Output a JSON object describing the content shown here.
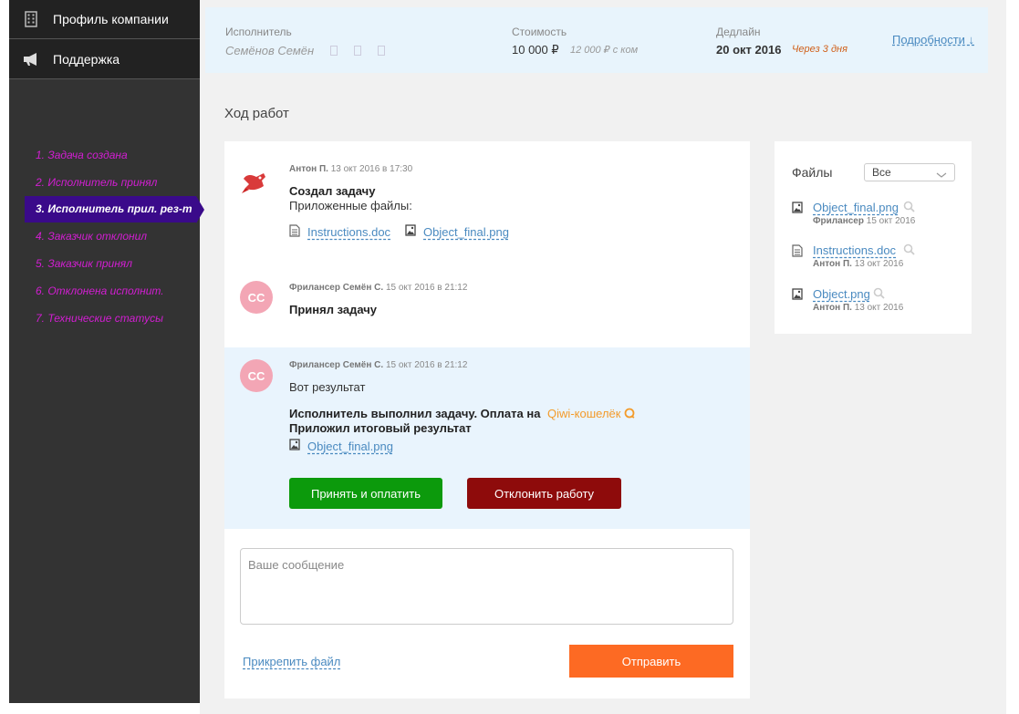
{
  "sidebar": {
    "menu": [
      {
        "label": "Профиль компании",
        "icon": "building-icon"
      },
      {
        "label": "Поддержка",
        "icon": "megaphone-icon"
      }
    ],
    "steps": [
      "1. Задача создана",
      "2. Исполнитель принял",
      "3. Исполнитель прил. рез-т",
      "4. Заказчик отклонил",
      "5. Заказчик принял",
      "6. Отклонена исполнит.",
      "7. Технические статусы"
    ],
    "active_step_index": 2
  },
  "info": {
    "executor_label": "Исполнитель",
    "executor_name": "Семёнов Семён",
    "cost_label": "Стоимость",
    "cost_value": "10 000 ₽",
    "cost_sub": "12 000 ₽ с ком",
    "deadline_label": "Дедлайн",
    "deadline_value": "20 окт 2016",
    "deadline_sub": "Через 3 дня",
    "details_link": "Подробности ↓"
  },
  "section_title": "Ход работ",
  "entries": [
    {
      "author": "Антон П.",
      "date": "13 окт 2016 в 17:30",
      "title": "Создал задачу",
      "text": "Приложенные файлы:",
      "files": [
        "Instructions.doc",
        "Object_final.png"
      ]
    },
    {
      "avatar": "СС",
      "author": "Фрилансер Семён С.",
      "date": "15 окт 2016 в 21:12",
      "title": "Принял задачу"
    },
    {
      "avatar": "СС",
      "author": "Фрилансер Семён С.",
      "date": "15 окт 2016 в 21:12",
      "text": "Вот результат",
      "bold_line1": "Исполнитель выполнил задачу. Оплата на",
      "wallet": "Qiwi-кошелёк",
      "bold_line2": "Приложил итоговый результат",
      "file": "Object_final.png",
      "accept_label": "Принять и оплатить",
      "reject_label": "Отклонить работу"
    }
  ],
  "composer": {
    "placeholder": "Ваше сообщение",
    "attach_label": "Прикрепить файл",
    "send_label": "Отправить"
  },
  "files_panel": {
    "title": "Файлы",
    "filter_value": "Все",
    "items": [
      {
        "name": "Object_final.png",
        "author": "Фрилансер",
        "date": "15 окт 2016"
      },
      {
        "name": "Instructions.doc",
        "author": "Антон П.",
        "date": "13 окт 2016"
      },
      {
        "name": "Object.png",
        "author": "Антон П.",
        "date": "13 окт 2016"
      }
    ]
  },
  "colors": {
    "sidebar_bg": "#333333",
    "step_text": "#d21ed2",
    "step_active_bg": "#3a0a8a",
    "accept": "#0c9a0c",
    "reject": "#8e0b0b",
    "send": "#fd6a23",
    "link": "#4a8ac0"
  }
}
